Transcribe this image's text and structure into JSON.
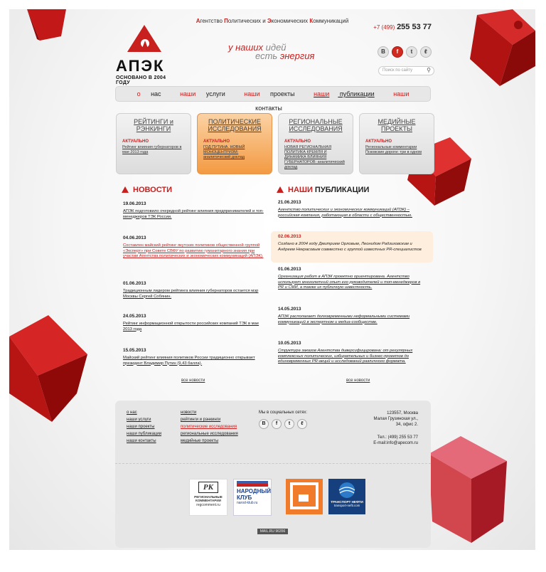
{
  "topbar": {
    "parts": [
      {
        "first": "А",
        "rest": "гентство "
      },
      {
        "first": "П",
        "rest": "олитических и "
      },
      {
        "first": "Э",
        "rest": "кономических "
      },
      {
        "first": "К",
        "rest": "оммуникаций"
      }
    ]
  },
  "phone": {
    "code": "+7 (499)",
    "number": "255 53 77"
  },
  "logo": {
    "name": "АПЭК",
    "since": "ОСНОВАНО В 2004 ГОДУ"
  },
  "slogan": {
    "line1_red": "у наших",
    "line1_gray": "идей",
    "line2_gray": "есть",
    "line2_red": "энергия"
  },
  "social": {
    "icons": [
      {
        "name": "vk-icon",
        "glyph": "В"
      },
      {
        "name": "facebook-icon",
        "glyph": "f"
      },
      {
        "name": "twitter-icon",
        "glyph": "t"
      },
      {
        "name": "livejournal-icon",
        "glyph": "ℓ"
      }
    ]
  },
  "search": {
    "placeholder": "Поиск по сайту"
  },
  "nav": {
    "items": [
      {
        "red": "о",
        "rest": " нас"
      },
      {
        "red": "наши",
        "rest": " услуги"
      },
      {
        "red": "наши",
        "rest": " проекты"
      },
      {
        "red": "наши",
        "rest": " публикации"
      },
      {
        "red": "наши",
        "rest": " контакты"
      }
    ]
  },
  "cards": [
    {
      "title": "РЕЙТИНГИ и РЭНКИНГИ",
      "label": "АКТУАЛЬНО",
      "text": "Рейтинг влияния губернаторов в мае 2013 года"
    },
    {
      "title": "ПОЛИТИЧЕСКИЕ ИССЛЕДОВАНИЯ",
      "label": "АКТУАЛЬНО",
      "text": "ГОД ПУТИНА. НОВЫЙ МОНОЦЕНТРИЗМ: аналитический доклад"
    },
    {
      "title": "РЕГИОНАЛЬНЫЕ ИССЛЕДОВАНИЯ",
      "label": "АКТУАЛЬНО",
      "text": "НОВАЯ РЕГИОНАЛЬНАЯ ПОЛИТИКА КРЕМЛЯ И ДИНАМИКА ВЛИЯНИЯ ГУБЕРНАТОРОВ: аналитический доклад"
    },
    {
      "title": "МЕДИЙНЫЕ ПРОЕКТЫ",
      "label": "АКТУАЛЬНО",
      "text": "Региональные комментарии Псковские дороги: три в одном"
    }
  ],
  "news": {
    "heading": "НОВОСТИ",
    "items": [
      {
        "date": "19.06.2013",
        "text": "АПЭК подготовило очередной рейтинг влияния предпринимателей и топ-менеджеров ТЭК России."
      },
      {
        "date": "04.06.2013",
        "text": "Составлен майский рейтинг якутских политиков общественной группой «Эксперт» при Совете СВФУ по развитию гуманитарного знания при участии Агентства политических и экономических коммуникаций (АПЭК)."
      },
      {
        "date": "01.06.2013",
        "text": "Традиционным лидером рейтинга влияния губернаторов остается мэр Москвы Сергей Собянин."
      },
      {
        "date": "24.05.2013",
        "text": "Рейтинг информационной открытости российских компаний ТЭК в мае 2013 года"
      },
      {
        "date": "15.05.2013",
        "text": "Майский рейтинг влияния политиков России традиционно открывает президент Владимир Путин (9,43 балла)."
      }
    ],
    "all": "все новости"
  },
  "pubs": {
    "heading_red": "НАШИ",
    "heading_dark": "ПУБЛИКАЦИИ",
    "items": [
      {
        "date": "21.06.2013",
        "text": "Агентство политических и экономических коммуникаций (АПЭК) – российская компания, работающая в области с общественностью."
      },
      {
        "date": "02.06.2013",
        "text": "Создано в 2004 году Дмитрием Орловым, Леонидом Радзиховским и Андреем Некрасовым совместно с группой известных PR-специалистов"
      },
      {
        "date": "01.06.2013",
        "text": "Организация работ в АПЭК проектно ориентирована. Агентство использует многолетний опыт его руководителей и топ-менеджеров в PR и СМИ, а также их публичную известность."
      },
      {
        "date": "14.05.2013",
        "text": "АПЭК располагает долговременными неформальными системами коммуникаций в экспертном и медиа-сообществе."
      },
      {
        "date": "10.05.2013",
        "text": "Структура заказов Агентства диверсифицирована: от регулярных комплексных политических, избирательных и бизнес-проектов до единовременных PR-акций и исследований различного формата."
      }
    ],
    "all": "все новости"
  },
  "footer": {
    "col1": [
      "о нас",
      "наши услуги",
      "наши проекты",
      "наши публикации",
      "наши контакты"
    ],
    "col2": [
      "новости",
      "рейтинги и рэнкинги",
      "политические исследования",
      "региональные исследования",
      "медийные проекты"
    ],
    "social_label": "Мы в социальных сетях:",
    "address": [
      "123557, Москва",
      "Малая Грузинская ул.,",
      "34, офис 2."
    ],
    "tel": "Тел.: (499) 255 53 77",
    "email": "E-mail:info@apecom.ru",
    "partners": [
      {
        "line1": "РК",
        "line2": "РЕГИОНАЛЬНЫЕ",
        "line3": "КОММЕНТАРИИ",
        "line4": "regcomment.ru"
      },
      {
        "line1": "НАРОДНЫЙ",
        "line2": "КЛУБ",
        "line3": "narod-klub.ru"
      },
      {
        "line1": ""
      },
      {
        "line1": "ТРАНСПОРТ НЕФТИ",
        "line2": "transport-nefti.com"
      }
    ],
    "counter": "MAIL.RU 96356"
  },
  "colors": {
    "accent": "#c8201f",
    "active_card": "#f39a42"
  }
}
